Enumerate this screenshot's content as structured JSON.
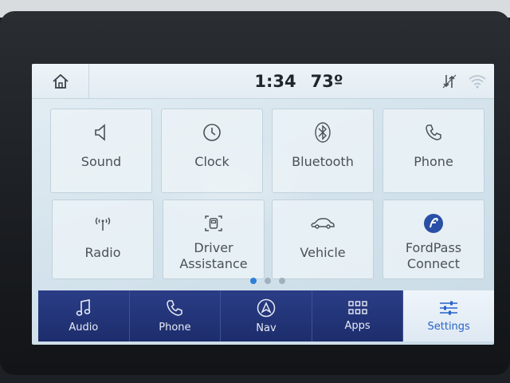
{
  "status": {
    "time": "1:34",
    "temperature": "73º"
  },
  "tiles": [
    {
      "label": "Sound",
      "icon": "speaker-icon"
    },
    {
      "label": "Clock",
      "icon": "clock-icon"
    },
    {
      "label": "Bluetooth",
      "icon": "bluetooth-icon"
    },
    {
      "label": "Phone",
      "icon": "phone-icon"
    },
    {
      "label": "Radio",
      "icon": "radio-antenna-icon"
    },
    {
      "label": "Driver\nAssistance",
      "icon": "driver-assistance-icon"
    },
    {
      "label": "Vehicle",
      "icon": "car-icon"
    },
    {
      "label": "FordPass\nConnect",
      "icon": "fordpass-icon"
    }
  ],
  "pager": {
    "pages": 3,
    "current": 1
  },
  "nav": [
    {
      "label": "Audio",
      "icon": "music-note-icon"
    },
    {
      "label": "Phone",
      "icon": "phone-icon"
    },
    {
      "label": "Nav",
      "icon": "navigation-arrow-icon"
    },
    {
      "label": "Apps",
      "icon": "apps-grid-icon"
    },
    {
      "label": "Settings",
      "icon": "sliders-icon",
      "active": true
    }
  ],
  "colors": {
    "nav_bg": "#24367a",
    "active_accent": "#2763c8",
    "screen_bg": "#d4e3ec"
  }
}
